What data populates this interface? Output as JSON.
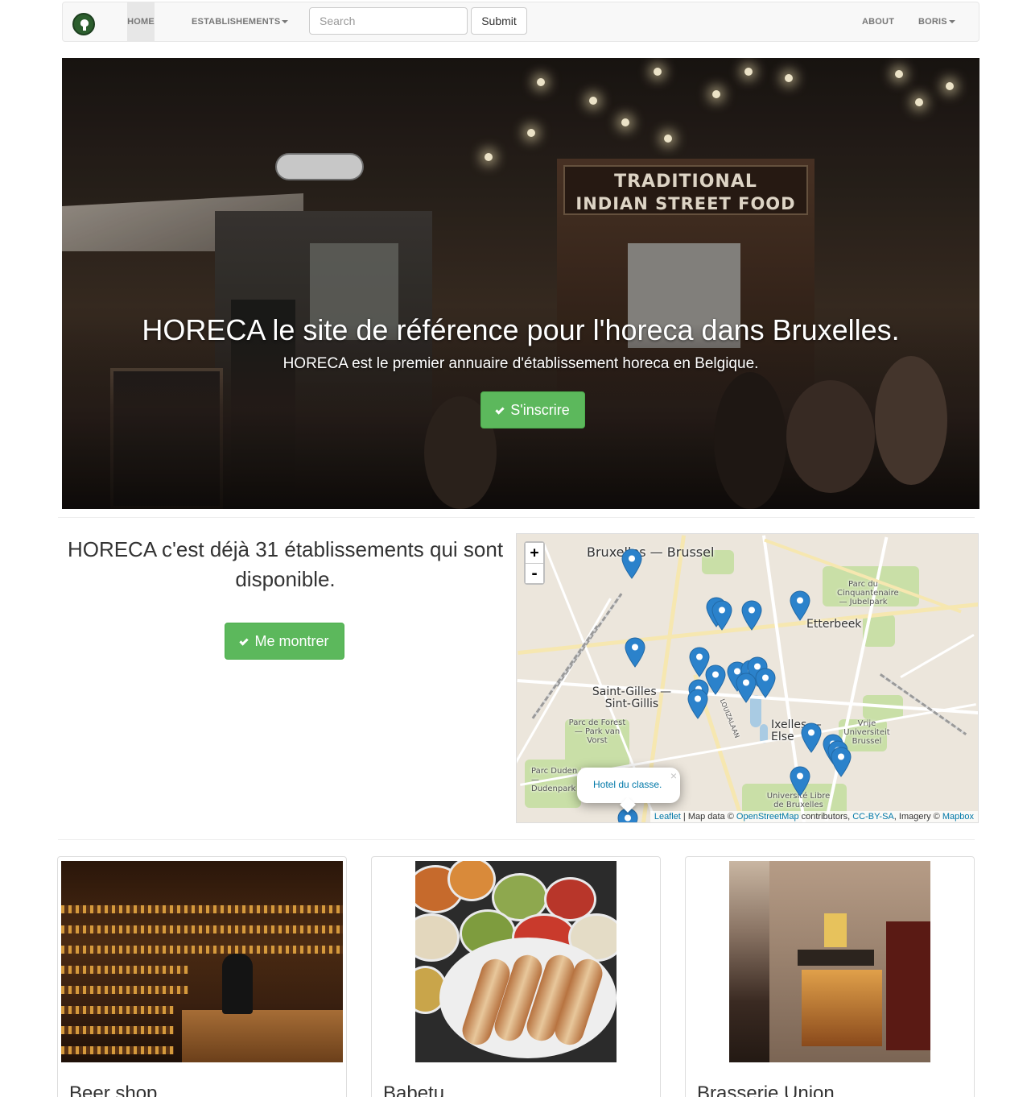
{
  "nav": {
    "home": "HOME",
    "establishments": "ESTABLISHEMENTS",
    "search_placeholder": "Search",
    "submit": "Submit",
    "about": "ABOUT",
    "user": "BORIS"
  },
  "hero": {
    "title": "HORECA le site de référence pour l'horeca dans Bruxelles.",
    "subtitle": "HORECA est le premier annuaire d'établissement horeca en Belgique.",
    "button": "S'inscrire",
    "signs": [
      "TRADITIONAL",
      "INDIAN STREET FOOD"
    ]
  },
  "intro": {
    "text": "HORECA c'est déjà 31 établissements qui sont disponible.",
    "button": "Me montrer"
  },
  "map": {
    "zoom_in": "+",
    "zoom_out": "-",
    "labels": {
      "city": "Bruxelles — Brussel",
      "etterbeek": "Etterbeek",
      "saint_gilles": "Saint-Gilles — Sint-Gillis",
      "ixelles": "Ixelles — Else",
      "cinquantenaire": "Parc du Cinquantenaire — Jubelpark",
      "forest": "Parc de Forest — Park van Vorst",
      "duden": "Parc Duden — Dudenpark",
      "vub": "Vrije Universiteit Brussel",
      "ulb": "Université Libre de Bruxelles",
      "louiza": "LOUIZALAAN"
    },
    "popup": "Hotel du classe.",
    "attribution": {
      "leaflet": "Leaflet",
      "map_data": " | Map data © ",
      "osm": "OpenStreetMap",
      "contrib": " contributors, ",
      "license": "CC-BY-SA",
      "imagery": ", Imagery © ",
      "mapbox": "Mapbox"
    },
    "marker_color": "#2b82cb"
  },
  "cards": [
    {
      "title": "Beer shop"
    },
    {
      "title": "Babetu"
    },
    {
      "title": "Brasserie Union"
    }
  ],
  "colors": {
    "success": "#5cb85c",
    "navbar_bg": "#f8f8f8",
    "link": "#0078a8"
  }
}
